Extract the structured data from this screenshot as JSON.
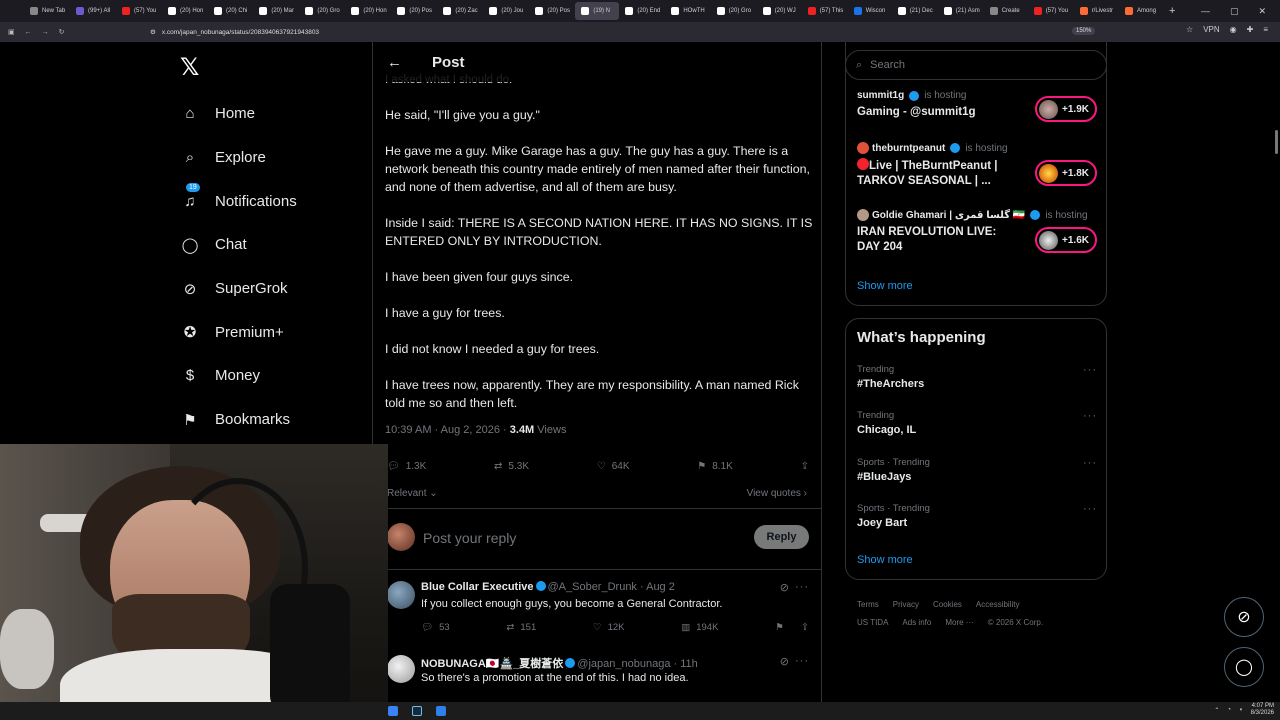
{
  "browser": {
    "tabs": [
      {
        "label": "New Tab",
        "fav": "g"
      },
      {
        "label": "(99+) All",
        "fav": "p"
      },
      {
        "label": "(57) You",
        "fav": "yt"
      },
      {
        "label": "(20) Hon",
        "fav": "x"
      },
      {
        "label": "(20) Chi",
        "fav": "x"
      },
      {
        "label": "(20) Mar",
        "fav": "x"
      },
      {
        "label": "(20) Gro",
        "fav": "x"
      },
      {
        "label": "(20) Hon",
        "fav": "x"
      },
      {
        "label": "(20) Pos",
        "fav": "x"
      },
      {
        "label": "(20) Zac",
        "fav": "x"
      },
      {
        "label": "(20) Jou",
        "fav": "x"
      },
      {
        "label": "(20) Pos",
        "fav": "x"
      },
      {
        "label": "(19) N",
        "fav": "x",
        "active": true
      },
      {
        "label": "(20) End",
        "fav": "x"
      },
      {
        "label": "HOwTH",
        "fav": "x"
      },
      {
        "label": "(20) Gro",
        "fav": "x"
      },
      {
        "label": "(20) WJ",
        "fav": "x"
      },
      {
        "label": "(57) This",
        "fav": "yt"
      },
      {
        "label": "Wiscon",
        "fav": "b"
      },
      {
        "label": "(21) Dec",
        "fav": "x"
      },
      {
        "label": "(21) Asm",
        "fav": "x"
      },
      {
        "label": "Create",
        "fav": "g"
      },
      {
        "label": "(57) You",
        "fav": "yt"
      },
      {
        "label": "r/Livestr",
        "fav": "o"
      },
      {
        "label": "Among",
        "fav": "o"
      }
    ],
    "url": "x.com/japan_nobunaga/status/2083940637921943803",
    "zoom": "150%",
    "vpn": "VPN"
  },
  "nav": {
    "items": [
      {
        "label": "Home",
        "icon": "home-icon",
        "glyph": "⌂"
      },
      {
        "label": "Explore",
        "icon": "search-icon",
        "glyph": "⌕"
      },
      {
        "label": "Notifications",
        "icon": "bell-icon",
        "glyph": "♫",
        "badge": "19"
      },
      {
        "label": "Chat",
        "icon": "chat-icon",
        "glyph": "◯"
      },
      {
        "label": "SuperGrok",
        "icon": "grok-icon",
        "glyph": "⊘"
      },
      {
        "label": "Premium+",
        "icon": "verified-icon",
        "glyph": "✪"
      },
      {
        "label": "Money",
        "icon": "money-icon",
        "glyph": "$"
      },
      {
        "label": "Bookmarks",
        "icon": "bookmark-icon",
        "glyph": "⚑"
      }
    ]
  },
  "post": {
    "header_title": "Post",
    "partial_top": "I asked what I should do.",
    "paragraphs": [
      "He said, \"I'll give you a guy.\"",
      "He gave me a guy. Mike Garage has a guy. The guy has a guy. There is a network beneath this country made entirely of men named after their function, and none of them advertise, and all of them are busy.",
      "Inside I said: THERE IS A SECOND NATION HERE. IT HAS NO SIGNS. IT IS ENTERED ONLY BY INTRODUCTION.",
      "I have been given four guys since.",
      "I have a guy for trees.",
      "I did not know I needed a guy for trees.",
      "I have trees now, apparently. They are my responsibility. A man named Rick told me so and then left."
    ],
    "time": "10:39 AM · Aug 2, 2026 ·",
    "views_count": "3.4M",
    "views_label": "Views",
    "replies": "1.3K",
    "reposts": "5.3K",
    "likes": "64K",
    "bookmarks": "8.1K",
    "sort": "Relevant",
    "view_quotes": "View quotes",
    "reply_placeholder": "Post your reply",
    "reply_button": "Reply"
  },
  "replies": [
    {
      "name": "Blue Collar Executive",
      "handle": "@A_Sober_Drunk · Aug 2",
      "text": "If you collect enough guys, you become a General Contractor.",
      "replies": "53",
      "reposts": "151",
      "likes": "12K",
      "views": "194K"
    },
    {
      "name": "NOBUNAGA🇯🇵🏯_夏樹蒼依",
      "handle": "@japan_nobunaga · 11h",
      "text": "So there's a promotion at the end of this. I had no idea."
    }
  ],
  "right": {
    "search_placeholder": "Search",
    "live": [
      {
        "host": "summit1g",
        "hosting": "is hosting",
        "title": "Gaming - @summit1g",
        "count": "+1.9K"
      },
      {
        "host": "theburntpeanut",
        "hosting": "is hosting",
        "title": "Live | TheBurntPeanut | TARKOV SEASONAL | ...",
        "count": "+1.8K"
      },
      {
        "host": "Goldie Ghamari | گلسا قمری 🇮🇷",
        "hosting": "is hosting",
        "title": "IRAN REVOLUTION LIVE: DAY 204",
        "count": "+1.6K"
      }
    ],
    "show_more_1": "Show more",
    "whats_happening": "What’s happening",
    "trends": [
      {
        "context": "Trending",
        "name": "#TheArchers"
      },
      {
        "context": "Trending",
        "name": "Chicago, IL"
      },
      {
        "context": "Sports · Trending",
        "name": "#BlueJays"
      },
      {
        "context": "Sports · Trending",
        "name": "Joey Bart"
      }
    ],
    "show_more_2": "Show more",
    "footer_line1": [
      "Terms",
      "Privacy",
      "Cookies",
      "Accessibility"
    ],
    "footer_line2": [
      "US TIDA",
      "Ads info",
      "More ···",
      "© 2026 X Corp."
    ]
  },
  "tray": {
    "time": "4:07 PM",
    "date": "8/3/2026"
  }
}
